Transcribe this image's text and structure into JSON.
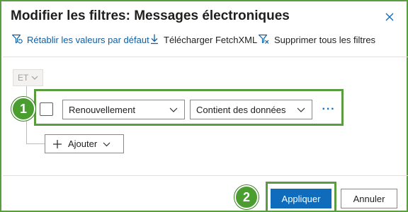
{
  "dialog": {
    "title": "Modifier les filtres: Messages électroniques",
    "close_icon": "close-icon"
  },
  "toolbar": {
    "reset_label": "Rétablir les valeurs par défaut",
    "download_label": "Télécharger FetchXML",
    "clear_label": "Supprimer tous les filtres",
    "reset_icon": "filter-reset-icon",
    "download_icon": "download-icon",
    "clear_icon": "filter-clear-icon"
  },
  "group": {
    "operator": "ET"
  },
  "filter_row": {
    "field_value": "Renouvellement",
    "operator_value": "Contient des données",
    "more_label": "···"
  },
  "add_button": {
    "label": "Ajouter"
  },
  "footer": {
    "apply_label": "Appliquer",
    "cancel_label": "Annuler"
  },
  "annotations": {
    "step1": "1",
    "step2": "2"
  },
  "colors": {
    "accent": "#0f6cbd",
    "highlight_green": "#5a9c3f",
    "badge_green": "#4a9d2f"
  }
}
